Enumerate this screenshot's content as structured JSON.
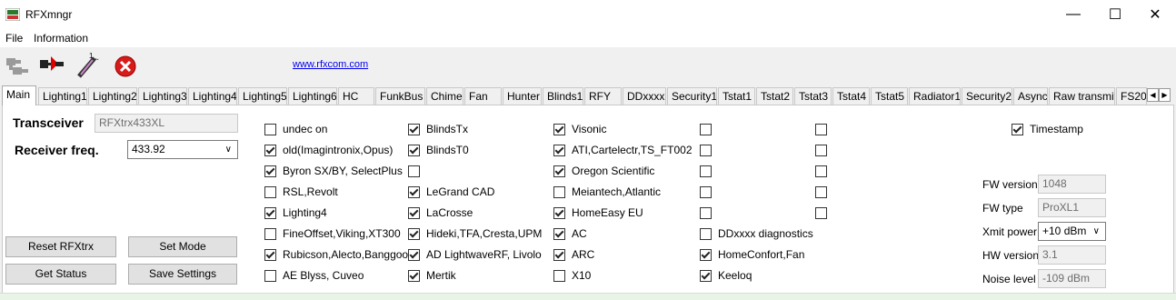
{
  "window": {
    "title": "RFXmngr",
    "minimize": "—",
    "maximize": "☐",
    "close": "✕"
  },
  "menu": [
    "File",
    "Information"
  ],
  "toolbar": {
    "link": "www.rfxcom.com",
    "icons": [
      "connect-icon",
      "disconnect-icon",
      "wand-icon",
      "stop-icon"
    ]
  },
  "tabs": [
    "Main",
    "Lighting1",
    "Lighting2",
    "Lighting3",
    "Lighting4",
    "Lighting5",
    "Lighting6",
    "HC",
    "FunkBus",
    "Chime",
    "Fan",
    "Hunter",
    "Blinds1",
    "RFY",
    "DDxxxx",
    "Security1",
    "Tstat1",
    "Tstat2",
    "Tstat3",
    "Tstat4",
    "Tstat5",
    "Radiator1",
    "Security2",
    "Async",
    "Raw transmit",
    "FS20"
  ],
  "main": {
    "transceiver_label": "Transceiver",
    "transceiver_value": "RFXtrx433XL",
    "receiver_label": "Receiver freq.",
    "receiver_value": "433.92",
    "buttons": {
      "reset": "Reset RFXtrx",
      "set_mode": "Set Mode",
      "get_status": "Get Status",
      "save_settings": "Save Settings"
    },
    "col1": [
      {
        "label": "undec on",
        "checked": false
      },
      {
        "label": "old(Imagintronix,Opus)",
        "checked": true
      },
      {
        "label": "Byron SX/BY, SelectPlus",
        "checked": true
      },
      {
        "label": "RSL,Revolt",
        "checked": false
      },
      {
        "label": "Lighting4",
        "checked": true
      },
      {
        "label": "FineOffset,Viking,XT300",
        "checked": false
      },
      {
        "label": "Rubicson,Alecto,Banggood",
        "checked": true
      },
      {
        "label": "AE Blyss, Cuveo",
        "checked": false
      }
    ],
    "col2": [
      {
        "label": "BlindsTx",
        "checked": true
      },
      {
        "label": "BlindsT0",
        "checked": true
      },
      {
        "label": "",
        "checked": false
      },
      {
        "label": "LeGrand CAD",
        "checked": true
      },
      {
        "label": "LaCrosse",
        "checked": true
      },
      {
        "label": "Hideki,TFA,Cresta,UPM",
        "checked": true
      },
      {
        "label": "AD LightwaveRF, Livolo",
        "checked": true
      },
      {
        "label": "Mertik",
        "checked": true
      }
    ],
    "col3": [
      {
        "label": "Visonic",
        "checked": true
      },
      {
        "label": "ATI,Cartelectr,TS_FT002",
        "checked": true
      },
      {
        "label": "Oregon Scientific",
        "checked": true
      },
      {
        "label": "Meiantech,Atlantic",
        "checked": false
      },
      {
        "label": "HomeEasy EU",
        "checked": true
      },
      {
        "label": "AC",
        "checked": true
      },
      {
        "label": "ARC",
        "checked": true
      },
      {
        "label": "X10",
        "checked": false
      }
    ],
    "col4": [
      {
        "label": "",
        "checked": false
      },
      {
        "label": "",
        "checked": false
      },
      {
        "label": "",
        "checked": false
      },
      {
        "label": "",
        "checked": false
      },
      {
        "label": "",
        "checked": false
      },
      {
        "label": "DDxxxx diagnostics",
        "checked": false
      },
      {
        "label": "HomeConfort,Fan",
        "checked": true
      },
      {
        "label": "Keeloq",
        "checked": true
      }
    ],
    "col5": [
      {
        "label": "",
        "checked": false
      },
      {
        "label": "",
        "checked": false
      },
      {
        "label": "",
        "checked": false
      },
      {
        "label": "",
        "checked": false
      },
      {
        "label": "",
        "checked": false
      }
    ],
    "timestamp": {
      "label": "Timestamp",
      "checked": true
    },
    "fw_version": {
      "label": "FW version",
      "value": "1048"
    },
    "fw_type": {
      "label": "FW type",
      "value": "ProXL1"
    },
    "xmit_power": {
      "label": "Xmit power",
      "value": "+10 dBm"
    },
    "hw_version": {
      "label": "HW version",
      "value": "3.1"
    },
    "noise_level": {
      "label": "Noise level",
      "value": "-109 dBm"
    }
  }
}
